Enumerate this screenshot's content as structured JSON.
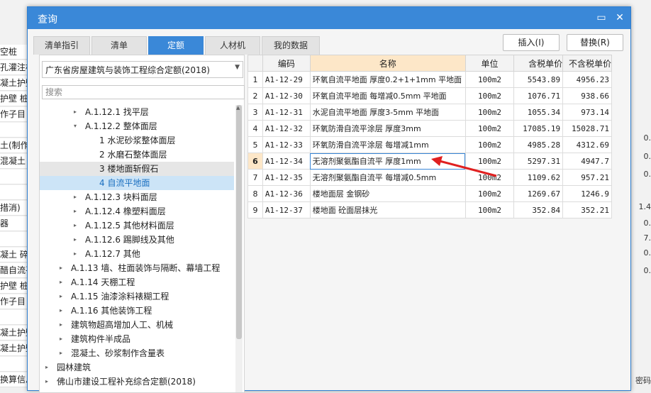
{
  "background": {
    "left_rows": [
      "空桩",
      "孔灌注桩",
      "凝土护壁",
      "护壁 桩",
      "作子目",
      "",
      "土(制作",
      "混凝土",
      "",
      "",
      "措消)",
      "器",
      "",
      "凝土 碎",
      "醋自流平",
      "护壁 桩",
      "作子目",
      "",
      "凝土护壁",
      "凝土护壁",
      "",
      "换算信息"
    ],
    "right_values": [
      "0.",
      "0.",
      "0.",
      "1.4",
      "0.",
      "7.",
      "0.",
      "0.",
      "密码"
    ]
  },
  "dialog": {
    "title": "查询",
    "minimize": "▭",
    "close": "✕",
    "tabs": [
      "清单指引",
      "清单",
      "定额",
      "人材机",
      "我的数据"
    ],
    "active_tab": "定额",
    "insert_button": "插入(I)",
    "replace_button": "替换(R)"
  },
  "left": {
    "library": "广东省房屋建筑与装饰工程综合定额(2018)",
    "search_placeholder": "搜索",
    "tree": [
      {
        "label": "A.1.12.1 找平层",
        "indent": 3,
        "arrow": "▸"
      },
      {
        "label": "A.1.12.2 整体面层",
        "indent": 3,
        "arrow": "▾"
      },
      {
        "label": "1 水泥砂浆整体面层",
        "indent": 4,
        "arrow": ""
      },
      {
        "label": "2 水磨石整体面层",
        "indent": 4,
        "arrow": ""
      },
      {
        "label": "3 楼地面斩假石",
        "indent": 4,
        "arrow": "",
        "state": "hl"
      },
      {
        "label": "4 自流平地面",
        "indent": 4,
        "arrow": "",
        "state": "sel"
      },
      {
        "label": "A.1.12.3 块料面层",
        "indent": 3,
        "arrow": "▸"
      },
      {
        "label": "A.1.12.4 橡塑料面层",
        "indent": 3,
        "arrow": "▸"
      },
      {
        "label": "A.1.12.5 其他材料面层",
        "indent": 3,
        "arrow": "▸"
      },
      {
        "label": "A.1.12.6 踢脚线及其他",
        "indent": 3,
        "arrow": "▸"
      },
      {
        "label": "A.1.12.7 其他",
        "indent": 3,
        "arrow": "▸"
      },
      {
        "label": "A.1.13 墙、柱面装饰与隔断、幕墙工程",
        "indent": 2,
        "arrow": "▸"
      },
      {
        "label": "A.1.14 天棚工程",
        "indent": 2,
        "arrow": "▸"
      },
      {
        "label": "A.1.15 油漆涂料裱糊工程",
        "indent": 2,
        "arrow": "▸"
      },
      {
        "label": "A.1.16 其他装饰工程",
        "indent": 2,
        "arrow": "▸"
      },
      {
        "label": "建筑物超高增加人工、机械",
        "indent": 2,
        "arrow": "▸"
      },
      {
        "label": "建筑构件半成品",
        "indent": 2,
        "arrow": "▸"
      },
      {
        "label": "混凝土、砂浆制作含量表",
        "indent": 2,
        "arrow": "▸"
      },
      {
        "label": "园林建筑",
        "indent": 1,
        "arrow": "▸"
      },
      {
        "label": "佛山市建设工程补充综合定额(2018)",
        "indent": 1,
        "arrow": "▸"
      }
    ]
  },
  "table": {
    "headers": [
      "",
      "编码",
      "名称",
      "单位",
      "含税单价",
      "不含税单价"
    ],
    "rows": [
      [
        "1",
        "A1-12-29",
        "环氧自流平地面 厚度0.2+1+1mm 平地面",
        "100m2",
        "5543.89",
        "4956.23"
      ],
      [
        "2",
        "A1-12-30",
        "环氧自流平地面 每增减0.5mm 平地面",
        "100m2",
        "1076.71",
        "938.66"
      ],
      [
        "3",
        "A1-12-31",
        "水泥自流平地面 厚度3-5mm 平地面",
        "100m2",
        "1055.34",
        "973.14"
      ],
      [
        "4",
        "A1-12-32",
        "环氧防滑自流平涂层 厚度3mm",
        "100m2",
        "17085.19",
        "15028.71"
      ],
      [
        "5",
        "A1-12-33",
        "环氧防滑自流平涂层 每增减1mm",
        "100m2",
        "4985.28",
        "4312.69"
      ],
      [
        "6",
        "A1-12-34",
        "无溶剂聚氨酯自流平 厚度1mm",
        "100m2",
        "5297.31",
        "4947.7"
      ],
      [
        "7",
        "A1-12-35",
        "无溶剂聚氨酯自流平 每增减0.5mm",
        "100m2",
        "1109.62",
        "957.21"
      ],
      [
        "8",
        "A1-12-36",
        "楼地面层 金钢砂",
        "100m2",
        "1269.67",
        "1246.9"
      ],
      [
        "9",
        "A1-12-37",
        "楼地面 砼面层抹光",
        "100m2",
        "352.84",
        "352.21"
      ]
    ],
    "active_row": "6",
    "arrow_color": "#e02020",
    "accent": "#3a88d8"
  }
}
